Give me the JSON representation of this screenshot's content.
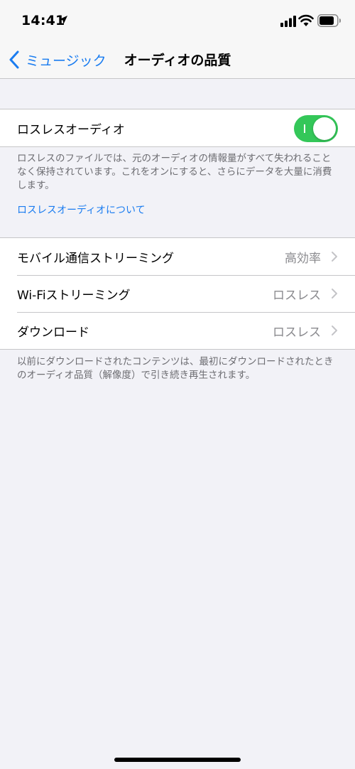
{
  "status_bar": {
    "time": "14:41"
  },
  "nav": {
    "back_label": "ミュージック",
    "title": "オーディオの品質"
  },
  "lossless": {
    "label": "ロスレスオーディオ",
    "enabled": true,
    "description": "ロスレスのファイルでは、元のオーディオの情報量がすべて失われることなく保持されています。これをオンにすると、さらにデータを大量に消費します。",
    "link": "ロスレスオーディオについて"
  },
  "streaming": {
    "rows": [
      {
        "label": "モバイル通信ストリーミング",
        "value": "高効率"
      },
      {
        "label": "Wi-Fiストリーミング",
        "value": "ロスレス"
      },
      {
        "label": "ダウンロード",
        "value": "ロスレス"
      }
    ],
    "footnote": "以前にダウンロードされたコンテンツは、最初にダウンロードされたときのオーディオ品質（解像度）で引き続き再生されます。"
  },
  "colors": {
    "accent": "#1a7cf0",
    "toggle_on": "#34c759"
  }
}
